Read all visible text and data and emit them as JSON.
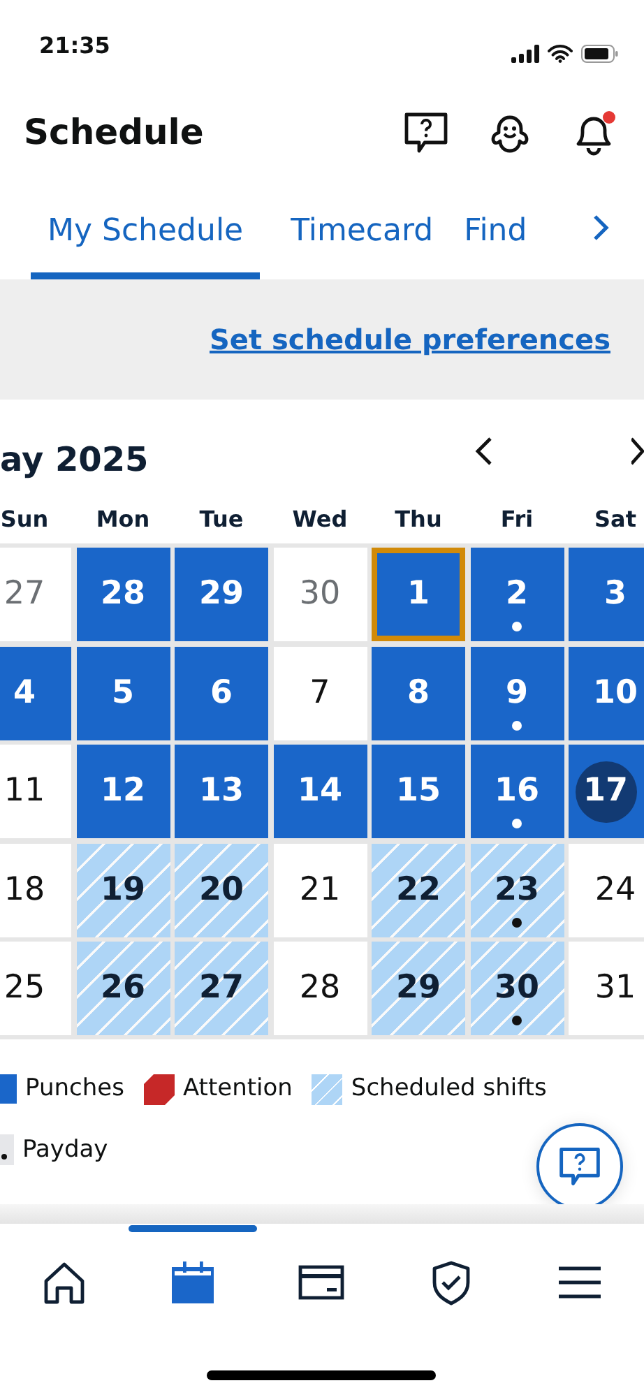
{
  "status_bar": {
    "time": "21:35"
  },
  "header": {
    "title": "Schedule"
  },
  "tabs": [
    {
      "label": "My Schedule",
      "selected": true
    },
    {
      "label": "Timecard",
      "selected": false
    },
    {
      "label": "Find",
      "selected": false
    }
  ],
  "preferences_link": "Set schedule preferences",
  "calendar": {
    "month": "ay 2025",
    "weekdays": [
      "Sun",
      "Mon",
      "Tue",
      "Wed",
      "Thu",
      "Fri",
      "Sat"
    ],
    "weeks": [
      [
        {
          "day": "27",
          "kind": "other",
          "selected": false,
          "today": false,
          "payday": false
        },
        {
          "day": "28",
          "kind": "punch",
          "selected": false,
          "today": false,
          "payday": false
        },
        {
          "day": "29",
          "kind": "punch",
          "selected": false,
          "today": false,
          "payday": false
        },
        {
          "day": "30",
          "kind": "other",
          "selected": false,
          "today": false,
          "payday": false
        },
        {
          "day": "1",
          "kind": "punch",
          "selected": true,
          "today": false,
          "payday": false
        },
        {
          "day": "2",
          "kind": "punch",
          "selected": false,
          "today": false,
          "payday": true
        },
        {
          "day": "3",
          "kind": "punch",
          "selected": false,
          "today": false,
          "payday": false
        }
      ],
      [
        {
          "day": "4",
          "kind": "punch",
          "selected": false,
          "today": false,
          "payday": false
        },
        {
          "day": "5",
          "kind": "punch",
          "selected": false,
          "today": false,
          "payday": false
        },
        {
          "day": "6",
          "kind": "punch",
          "selected": false,
          "today": false,
          "payday": false
        },
        {
          "day": "7",
          "kind": "plain",
          "selected": false,
          "today": false,
          "payday": false
        },
        {
          "day": "8",
          "kind": "punch",
          "selected": false,
          "today": false,
          "payday": false
        },
        {
          "day": "9",
          "kind": "punch",
          "selected": false,
          "today": false,
          "payday": true
        },
        {
          "day": "10",
          "kind": "punch",
          "selected": false,
          "today": false,
          "payday": false
        }
      ],
      [
        {
          "day": "11",
          "kind": "plain",
          "selected": false,
          "today": false,
          "payday": false
        },
        {
          "day": "12",
          "kind": "punch",
          "selected": false,
          "today": false,
          "payday": false
        },
        {
          "day": "13",
          "kind": "punch",
          "selected": false,
          "today": false,
          "payday": false
        },
        {
          "day": "14",
          "kind": "punch",
          "selected": false,
          "today": false,
          "payday": false
        },
        {
          "day": "15",
          "kind": "punch",
          "selected": false,
          "today": false,
          "payday": false
        },
        {
          "day": "16",
          "kind": "punch",
          "selected": false,
          "today": false,
          "payday": true
        },
        {
          "day": "17",
          "kind": "punch",
          "selected": false,
          "today": true,
          "payday": false
        }
      ],
      [
        {
          "day": "18",
          "kind": "plain",
          "selected": false,
          "today": false,
          "payday": false
        },
        {
          "day": "19",
          "kind": "scheduled",
          "selected": false,
          "today": false,
          "payday": false
        },
        {
          "day": "20",
          "kind": "scheduled",
          "selected": false,
          "today": false,
          "payday": false
        },
        {
          "day": "21",
          "kind": "plain",
          "selected": false,
          "today": false,
          "payday": false
        },
        {
          "day": "22",
          "kind": "scheduled",
          "selected": false,
          "today": false,
          "payday": false
        },
        {
          "day": "23",
          "kind": "scheduled",
          "selected": false,
          "today": false,
          "payday": true
        },
        {
          "day": "24",
          "kind": "plain",
          "selected": false,
          "today": false,
          "payday": false
        }
      ],
      [
        {
          "day": "25",
          "kind": "plain",
          "selected": false,
          "today": false,
          "payday": false
        },
        {
          "day": "26",
          "kind": "scheduled",
          "selected": false,
          "today": false,
          "payday": false
        },
        {
          "day": "27",
          "kind": "scheduled",
          "selected": false,
          "today": false,
          "payday": false
        },
        {
          "day": "28",
          "kind": "plain",
          "selected": false,
          "today": false,
          "payday": false
        },
        {
          "day": "29",
          "kind": "scheduled",
          "selected": false,
          "today": false,
          "payday": false
        },
        {
          "day": "30",
          "kind": "scheduled",
          "selected": false,
          "today": false,
          "payday": true
        },
        {
          "day": "31",
          "kind": "plain",
          "selected": false,
          "today": false,
          "payday": false
        }
      ]
    ]
  },
  "legend": [
    {
      "kind": "punch",
      "label": "Punches"
    },
    {
      "kind": "attention",
      "label": "Attention"
    },
    {
      "kind": "scheduled",
      "label": "Scheduled shifts"
    },
    {
      "kind": "payday",
      "label": "Payday"
    }
  ],
  "bottom_nav": [
    {
      "kind": "home",
      "selected": false
    },
    {
      "kind": "calendar",
      "selected": true
    },
    {
      "kind": "card",
      "selected": false
    },
    {
      "kind": "shield",
      "selected": false
    },
    {
      "kind": "menu",
      "selected": false
    }
  ]
}
